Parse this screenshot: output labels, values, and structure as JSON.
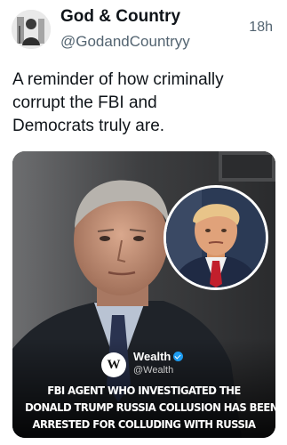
{
  "post": {
    "display_name": "God & Country",
    "handle": "@GodandCountryy",
    "timestamp": "18h",
    "text": "A reminder of how criminally\ncorrupt the FBI and\nDemocrats truly are."
  },
  "media": {
    "brand": {
      "logo_text": "W",
      "name": "Wealth",
      "handle": "@Wealth",
      "verified_icon": "verified-badge-icon"
    },
    "headline_lines": [
      "FBI AGENT WHO INVESTIGATED THE",
      "DONALD TRUMP RUSSIA COLLUSION HAS BEEN",
      "ARRESTED FOR COLLUDING WITH RUSSIA"
    ]
  },
  "colors": {
    "text_primary": "#0f1419",
    "text_secondary": "#536471",
    "verified_blue": "#1d9bf0"
  }
}
